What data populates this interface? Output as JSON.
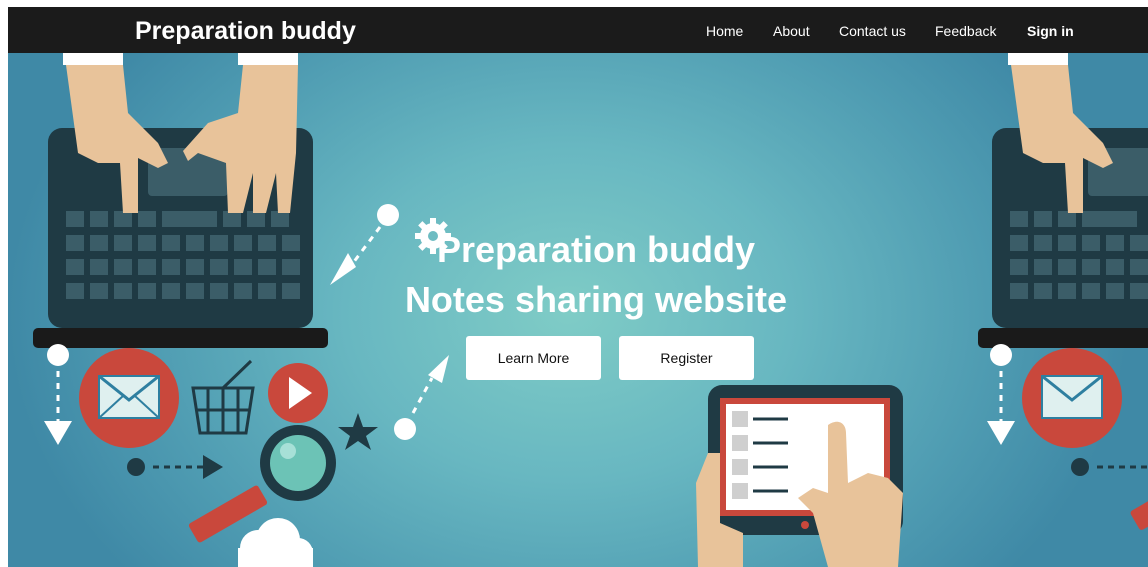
{
  "navbar": {
    "brand": "Preparation buddy",
    "links": [
      {
        "label": "Home"
      },
      {
        "label": "About"
      },
      {
        "label": "Contact us"
      },
      {
        "label": "Feedback"
      },
      {
        "label": "Sign in"
      }
    ]
  },
  "hero": {
    "title_line1": "Preparation buddy",
    "title_line2": "Notes sharing website",
    "buttons": {
      "learn_more": "Learn More",
      "register": "Register"
    }
  },
  "colors": {
    "navbar_bg": "#1b1b1b",
    "hero_center": "#7fccc6",
    "hero_edge": "#3f89a6",
    "laptop": "#1f3a44",
    "mail_red": "#c9483c",
    "skin": "#e8c39a"
  },
  "icons": [
    "gear-icon",
    "mail-icon",
    "cart-icon",
    "play-icon",
    "magnifier-icon",
    "star-icon",
    "cloud-icon",
    "tablet-icon",
    "laptop-icon",
    "hand-icon"
  ]
}
